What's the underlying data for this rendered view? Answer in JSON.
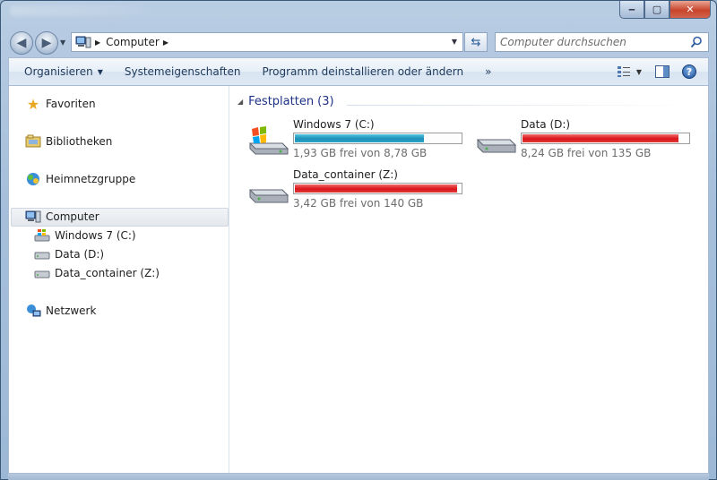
{
  "window": {
    "minimize_glyph": "‒",
    "maximize_glyph": "▢",
    "close_glyph": "✕"
  },
  "address_bar": {
    "location": "Computer",
    "search_placeholder": "Computer durchsuchen"
  },
  "toolbar": {
    "organize_label": "Organisieren",
    "system_props_label": "Systemeigenschaften",
    "uninstall_label": "Programm deinstallieren oder ändern",
    "more_label": "»"
  },
  "navigation": {
    "favorites": "Favoriten",
    "libraries": "Bibliotheken",
    "homegroup": "Heimnetzgruppe",
    "computer": "Computer",
    "drives": [
      {
        "label": "Windows 7 (C:)"
      },
      {
        "label": "Data (D:)"
      },
      {
        "label": "Data_container (Z:)"
      }
    ],
    "network": "Netzwerk"
  },
  "main": {
    "group_title": "Festplatten (3)",
    "drives": [
      {
        "name": "Windows 7 (C:)",
        "free_text": "1,93 GB frei von 8,78 GB",
        "used_fraction": 0.78,
        "bar_color": "#1e8fb7",
        "icon": "windows-drive-icon"
      },
      {
        "name": "Data (D:)",
        "free_text": "8,24 GB frei von 135 GB",
        "used_fraction": 0.94,
        "bar_color": "#d9151b",
        "icon": "hard-drive-icon"
      },
      {
        "name": "Data_container (Z:)",
        "free_text": "3,42 GB frei von 140 GB",
        "used_fraction": 0.98,
        "bar_color": "#d9151b",
        "icon": "hard-drive-icon"
      }
    ]
  },
  "colors": {
    "accent_link": "#1e3287",
    "toolbar_text": "#1e395b"
  }
}
